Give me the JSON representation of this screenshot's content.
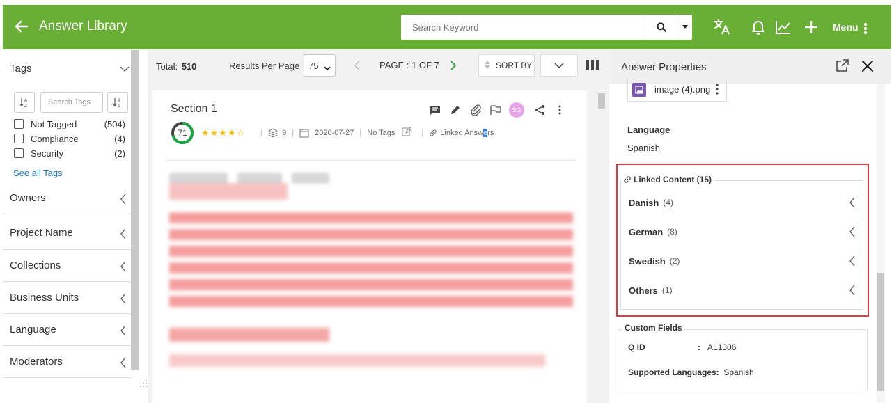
{
  "app": {
    "title": "Answer Library"
  },
  "search": {
    "placeholder": "Search Keyword"
  },
  "topbar": {
    "menu_label": "Menu"
  },
  "sidebar": {
    "tags_heading": "Tags",
    "search_tags_placeholder": "Search Tags",
    "sort_asc_label": "↓A Z",
    "sort_num_label": "↓9 1",
    "tags": [
      {
        "name": "Not Tagged",
        "count": "(504)"
      },
      {
        "name": "Compliance",
        "count": "(4)"
      },
      {
        "name": "Security",
        "count": "(2)"
      }
    ],
    "see_all": "See all Tags",
    "sections": [
      {
        "label": "Owners"
      },
      {
        "label": "Project Name"
      },
      {
        "label": "Collections"
      },
      {
        "label": "Business Units"
      },
      {
        "label": "Language"
      },
      {
        "label": "Moderators"
      }
    ]
  },
  "toolbar": {
    "total_label": "Total:",
    "total_value": "510",
    "results_per_page_label": "Results Per Page",
    "results_per_page_value": "75",
    "page_label": "PAGE : 1 OF 7",
    "sort_label": "SORT BY"
  },
  "card": {
    "section_title": "Section 1",
    "avatar_initials": "SG",
    "score": "71",
    "score_fraction": 0.71,
    "stars": "★★★★☆",
    "rating": 4,
    "versions": "9",
    "date": "2020-07-27",
    "tags_text": "No Tags",
    "linked_text_a": "Linked Answ",
    "linked_text_b": "e",
    "linked_text_c": "rs"
  },
  "right_panel": {
    "title": "Answer Properties",
    "file_name": "image (4).png",
    "language_label": "Language",
    "language_value": "Spanish",
    "linked_content_title": "Linked Content (15)",
    "linked_items": [
      {
        "name": "Danish",
        "count": "(4)"
      },
      {
        "name": "German",
        "count": "(8)"
      },
      {
        "name": "Swedish",
        "count": "(2)"
      },
      {
        "name": "Others",
        "count": "(1)"
      }
    ],
    "custom_fields_title": "Custom Fields",
    "qid_label": "Q ID",
    "qid_sep": ":",
    "qid_value": "AL1306",
    "supported_languages_label": "Supported Languages:",
    "supported_languages_value": "Spanish"
  },
  "colors": {
    "brand_green": "#6aaf35",
    "highlight_red": "#e0393e",
    "link_blue": "#1a7cc1",
    "star_gold": "#f2b705",
    "score_ring": "#1aa545"
  }
}
